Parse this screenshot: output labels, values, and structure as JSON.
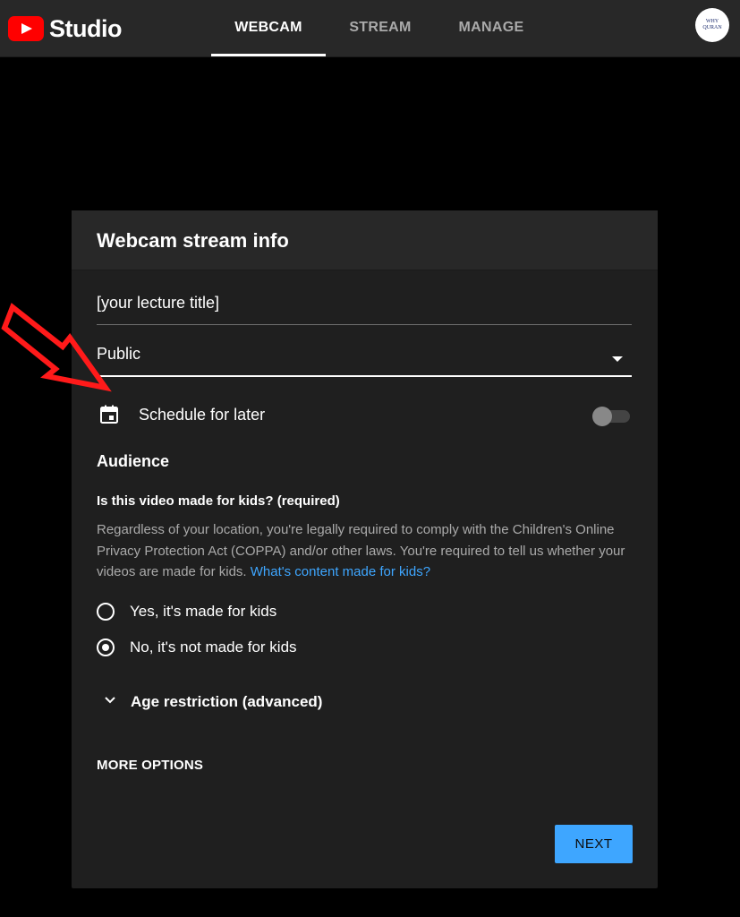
{
  "app": {
    "name": "Studio",
    "tabs": [
      {
        "label": "WEBCAM",
        "active": true
      },
      {
        "label": "STREAM",
        "active": false
      },
      {
        "label": "MANAGE",
        "active": false
      }
    ],
    "avatar_text": [
      "WHY",
      "QURAN"
    ]
  },
  "dialog": {
    "title": "Webcam stream info",
    "title_field_value": "[your lecture title]",
    "privacy_value": "Public",
    "schedule_label": "Schedule for later",
    "schedule_enabled": false,
    "audience_heading": "Audience",
    "kids_question": "Is this video made for kids? (required)",
    "kids_description": "Regardless of your location, you're legally required to comply with the Children's Online Privacy Protection Act (COPPA) and/or other laws. You're required to tell us whether your videos are made for kids.",
    "kids_link": "What's content made for kids?",
    "radio_options": [
      {
        "label": "Yes, it's made for kids",
        "checked": false
      },
      {
        "label": "No, it's not made for kids",
        "checked": true
      }
    ],
    "age_restriction_label": "Age restriction (advanced)",
    "more_options_label": "MORE OPTIONS",
    "next_label": "NEXT"
  },
  "colors": {
    "brand_red": "#ff0000",
    "accent_blue": "#3ea6ff",
    "annotation_red": "#ff1a1a"
  }
}
